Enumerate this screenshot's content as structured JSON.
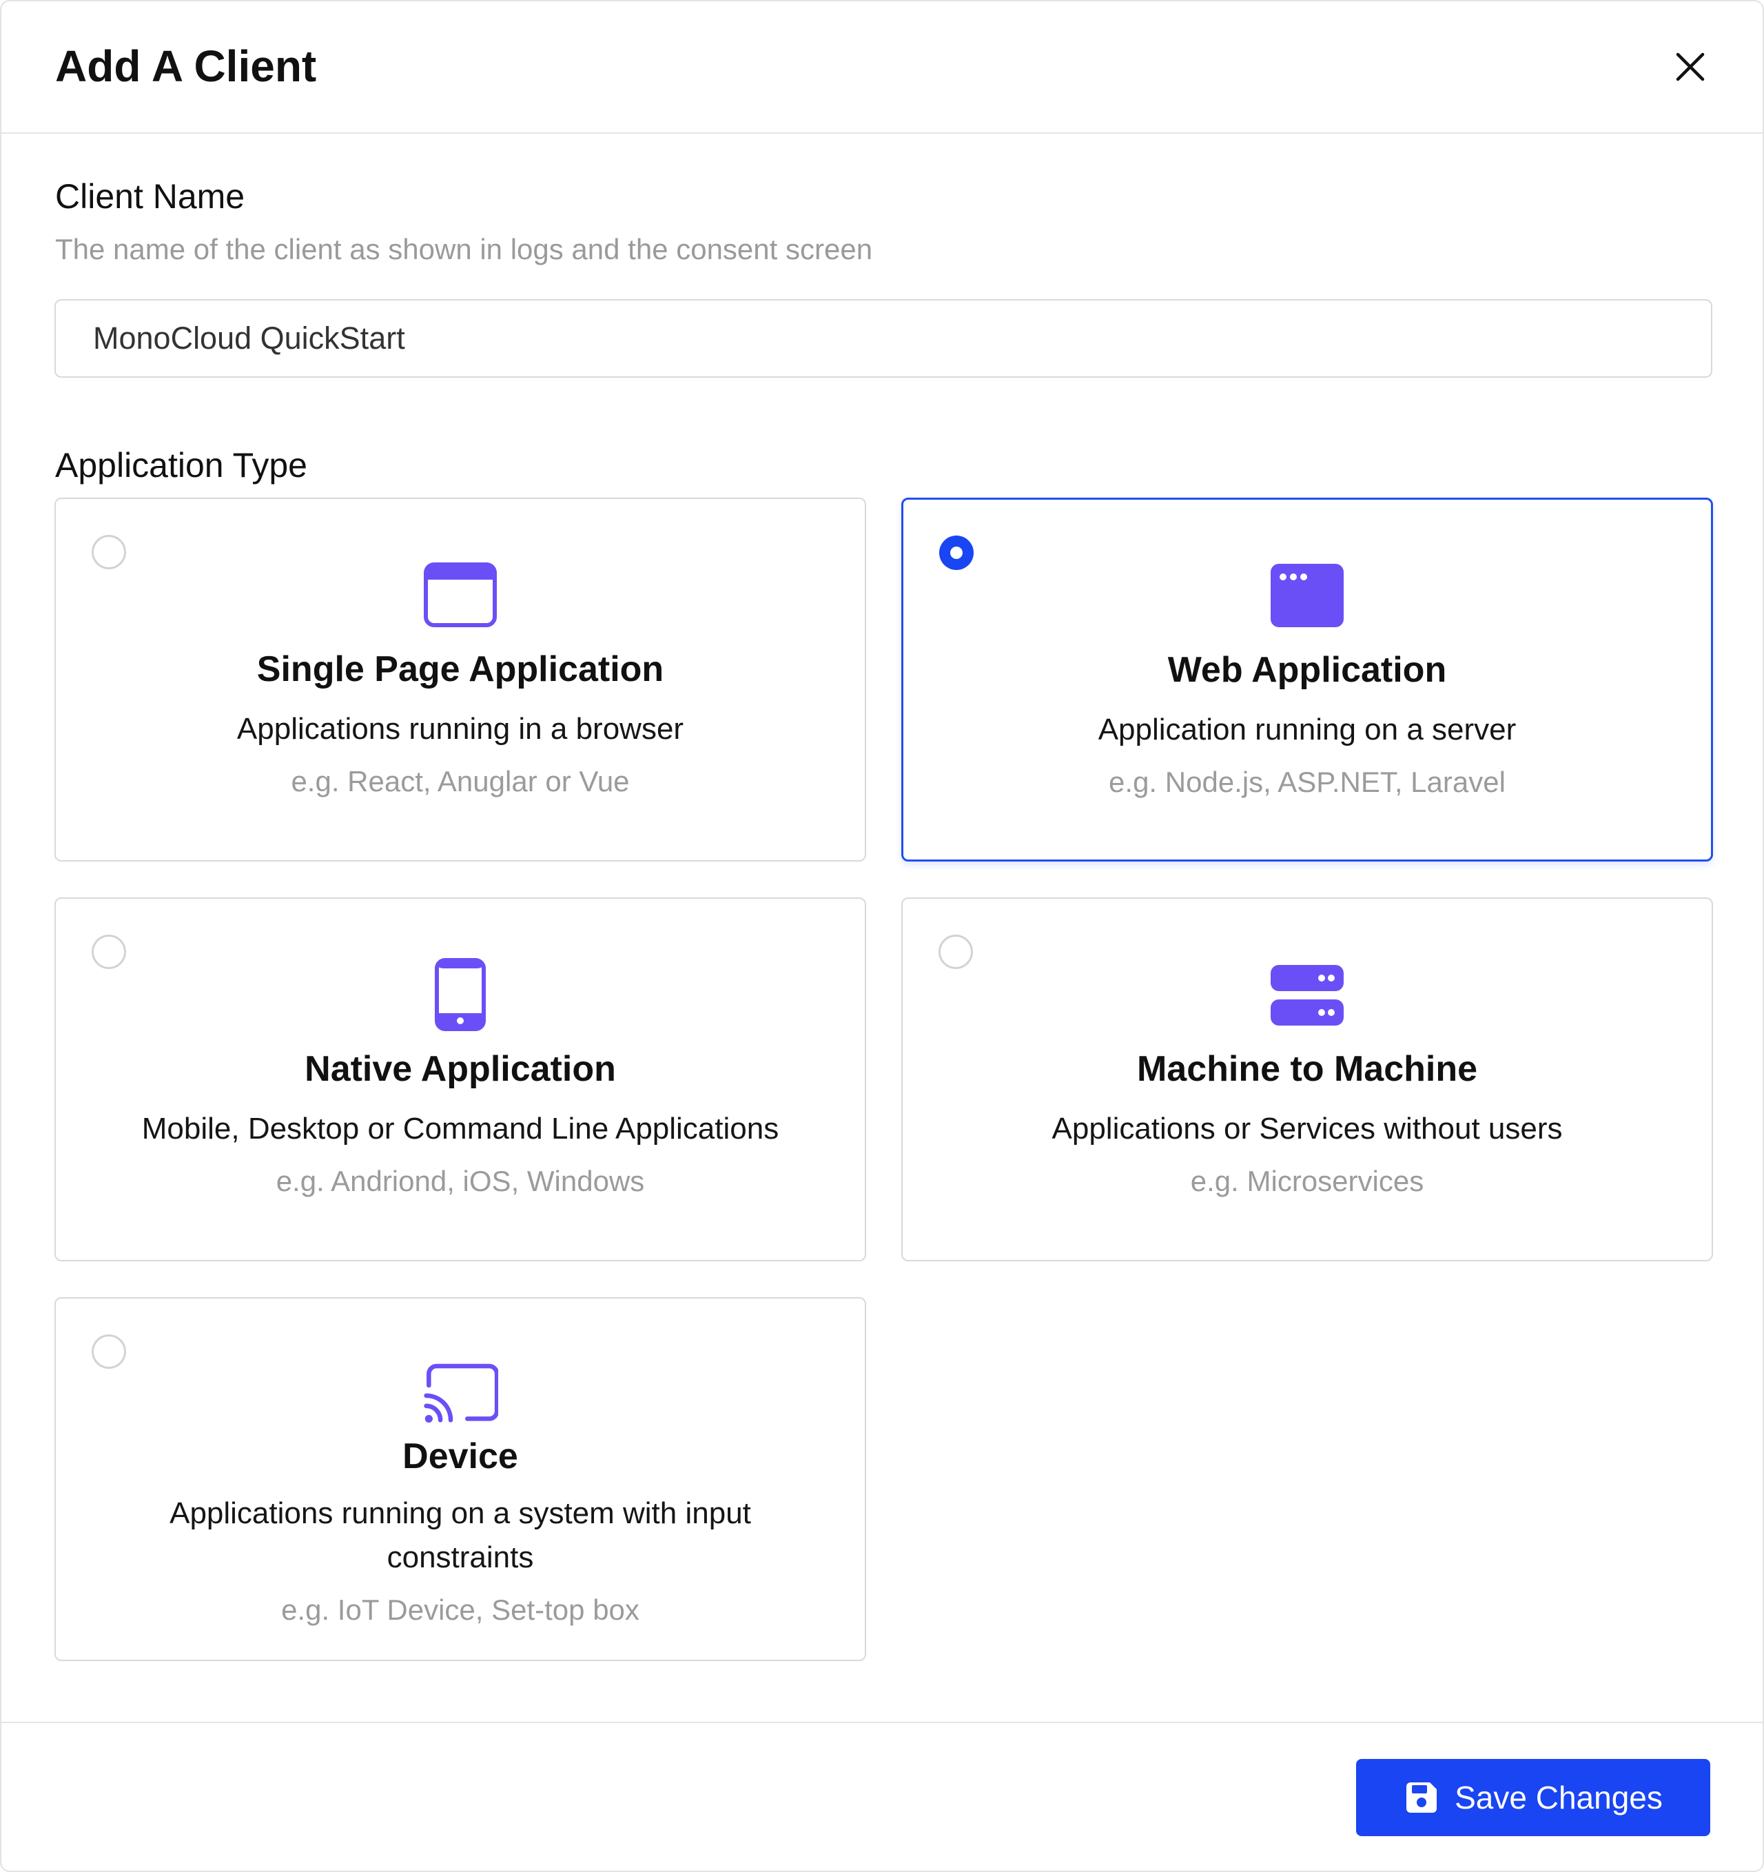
{
  "dialog": {
    "title": "Add A Client"
  },
  "client_name": {
    "label": "Client Name",
    "help": "The name of the client as shown in logs and the consent screen",
    "value": "MonoCloud QuickStart"
  },
  "application_type": {
    "label": "Application Type",
    "selected": "web-application",
    "options": [
      {
        "id": "single-page-application",
        "icon": "browser-window-icon",
        "title": "Single Page Application",
        "description": "Applications running in a browser",
        "example": "e.g. React, Anuglar or Vue"
      },
      {
        "id": "web-application",
        "icon": "web-app-window-icon",
        "title": "Web Application",
        "description": "Application running on a server",
        "example": "e.g. Node.js, ASP.NET, Laravel"
      },
      {
        "id": "native-application",
        "icon": "mobile-device-icon",
        "title": "Native Application",
        "description": "Mobile, Desktop or Command Line Applications",
        "example": "e.g. Andriond, iOS, Windows"
      },
      {
        "id": "machine-to-machine",
        "icon": "server-icon",
        "title": "Machine to Machine",
        "description": "Applications or Services without users",
        "example": "e.g. Microservices"
      },
      {
        "id": "device",
        "icon": "cast-icon",
        "title": "Device",
        "description": "Applications running on a system with input constraints",
        "example": "e.g. IoT Device, Set-top box"
      }
    ]
  },
  "footer": {
    "save_label": "Save Changes"
  },
  "colors": {
    "accent": "#1a45f2",
    "icon": "#6b4ff6",
    "muted_text": "#9b9b9b",
    "border": "#d9d9d9"
  }
}
